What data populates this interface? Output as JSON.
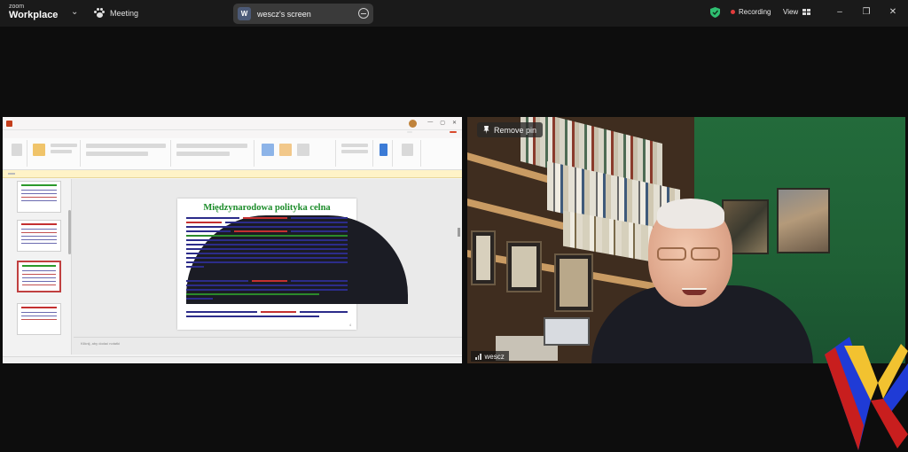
{
  "app": {
    "brand_small": "zoom",
    "brand_large": "Workplace"
  },
  "meeting": {
    "label": "Meeting"
  },
  "share": {
    "badge_letter": "W",
    "title": "wescz's screen"
  },
  "status": {
    "recording_label": "Recording",
    "view_label": "View"
  },
  "window_controls": {
    "minimize": "–",
    "restore": "❐",
    "close": "✕"
  },
  "presentation": {
    "slide_title": "Międzynarodowa polityka celna",
    "notes_placeholder": "Kliknij, aby dodać notatki"
  },
  "camera": {
    "remove_pin_label": "Remove pin",
    "participant_name": "wescz"
  },
  "colors": {
    "accent_green": "#2fbf71",
    "record_red": "#e23b3b",
    "slide_title_green": "#1c8c2a",
    "wall_green": "#236b3b"
  }
}
